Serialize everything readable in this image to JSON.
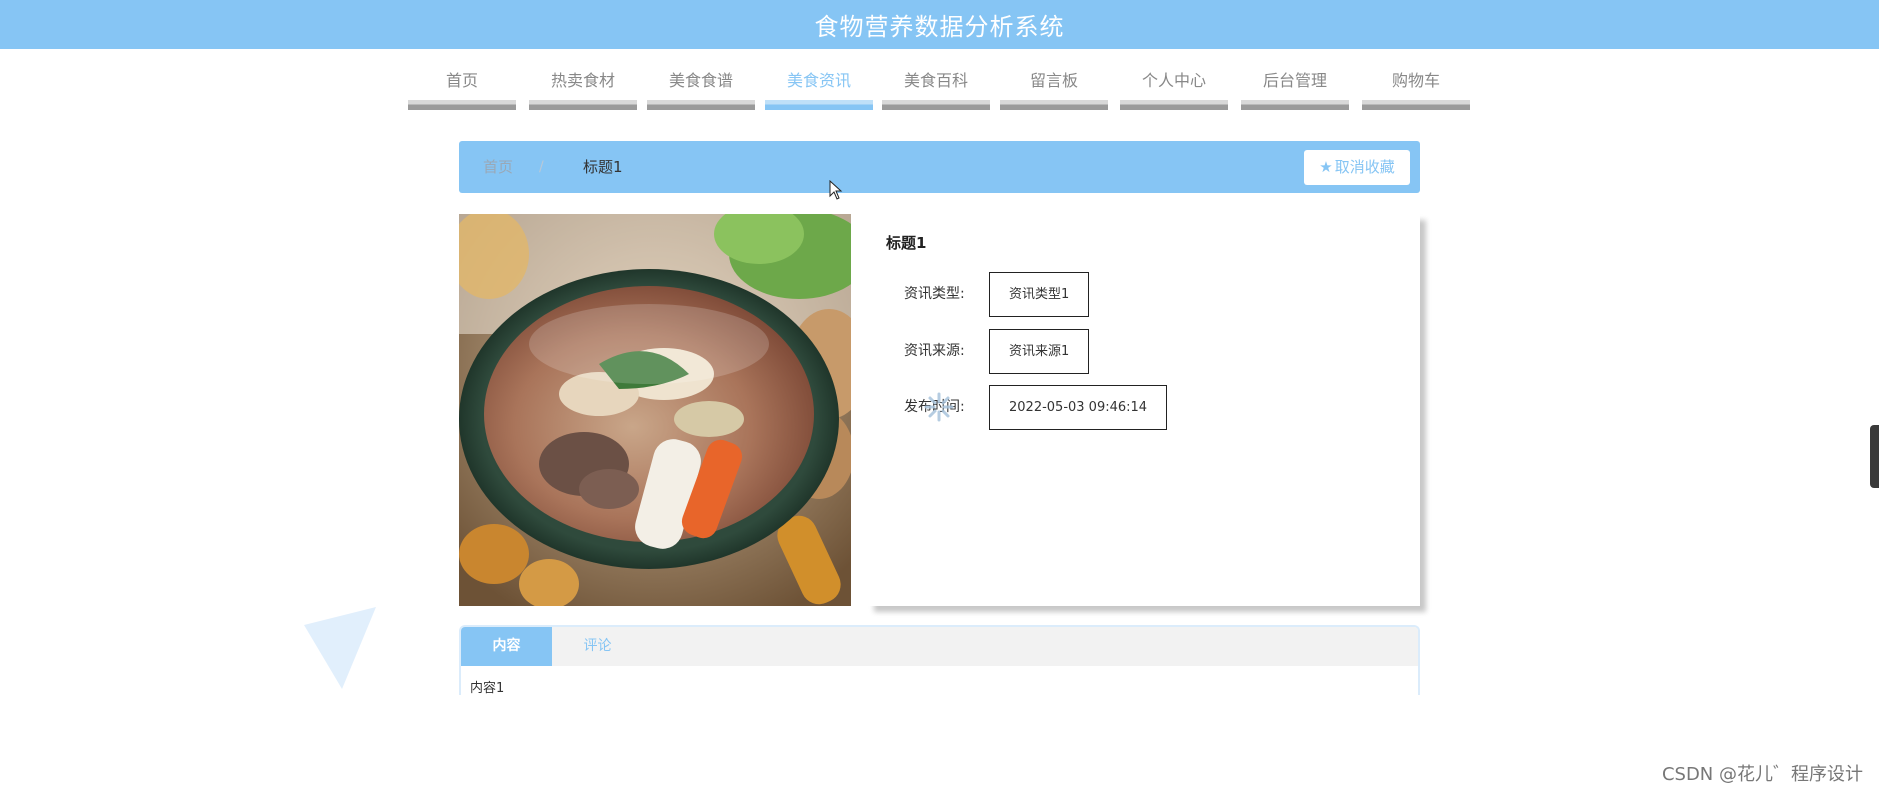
{
  "header": {
    "title": "食物营养数据分析系统"
  },
  "nav": {
    "items": [
      {
        "label": "首页",
        "active": false
      },
      {
        "label": "热卖食材",
        "active": false
      },
      {
        "label": "美食食谱",
        "active": false
      },
      {
        "label": "美食资讯",
        "active": true
      },
      {
        "label": "美食百科",
        "active": false
      },
      {
        "label": "留言板",
        "active": false
      },
      {
        "label": "个人中心",
        "active": false
      },
      {
        "label": "后台管理",
        "active": false
      },
      {
        "label": "购物车",
        "active": false
      }
    ]
  },
  "breadcrumb": {
    "home": "首页",
    "separator": "/",
    "current": "标题1"
  },
  "favorite_button": {
    "icon": "star-icon",
    "label": "取消收藏"
  },
  "detail": {
    "image": "food-photo-stew",
    "title": "标题1",
    "fields": [
      {
        "key": "资讯类型:",
        "value": "资讯类型1"
      },
      {
        "key": "资讯来源:",
        "value": "资讯来源1"
      },
      {
        "key": "发布时间:",
        "value": "2022-05-03 09:46:14"
      }
    ]
  },
  "tabs": {
    "items": [
      {
        "label": "内容",
        "active": true
      },
      {
        "label": "评论",
        "active": false
      }
    ],
    "content": "内容1"
  },
  "watermark": "CSDN @花儿゛程序设计",
  "colors": {
    "accent": "#86c5f4",
    "nav_bar": "#9a9a9a"
  }
}
